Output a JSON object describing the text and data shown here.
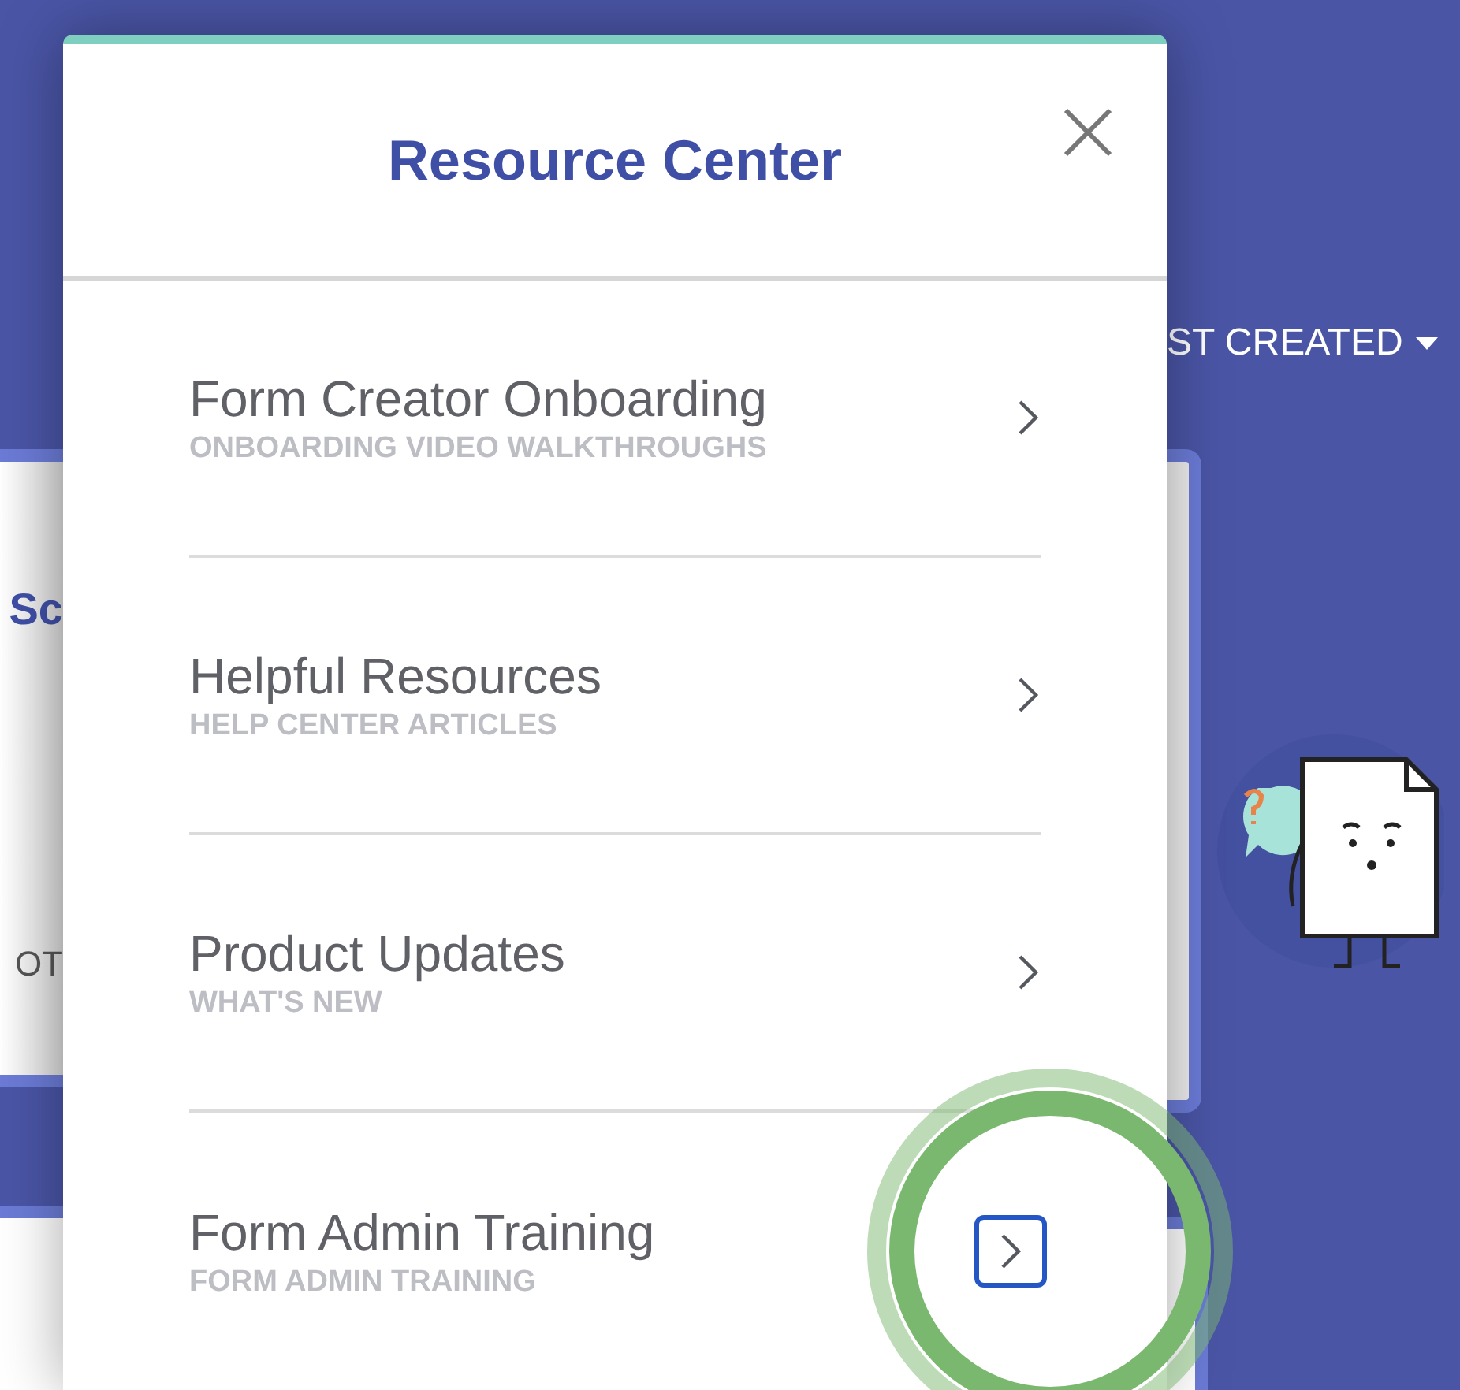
{
  "background": {
    "sort_label": "ST CREATED",
    "card_title": "Sc",
    "card_text": "OT"
  },
  "panel": {
    "title": "Resource Center"
  },
  "items": [
    {
      "title": "Form Creator Onboarding",
      "subtitle": "ONBOARDING VIDEO WALKTHROUGHS",
      "focused": false
    },
    {
      "title": "Helpful Resources",
      "subtitle": "HELP CENTER ARTICLES",
      "focused": false
    },
    {
      "title": "Product Updates",
      "subtitle": "WHAT'S NEW",
      "focused": false
    },
    {
      "title": "Form Admin Training",
      "subtitle": "FORM ADMIN TRAINING",
      "focused": true
    }
  ]
}
